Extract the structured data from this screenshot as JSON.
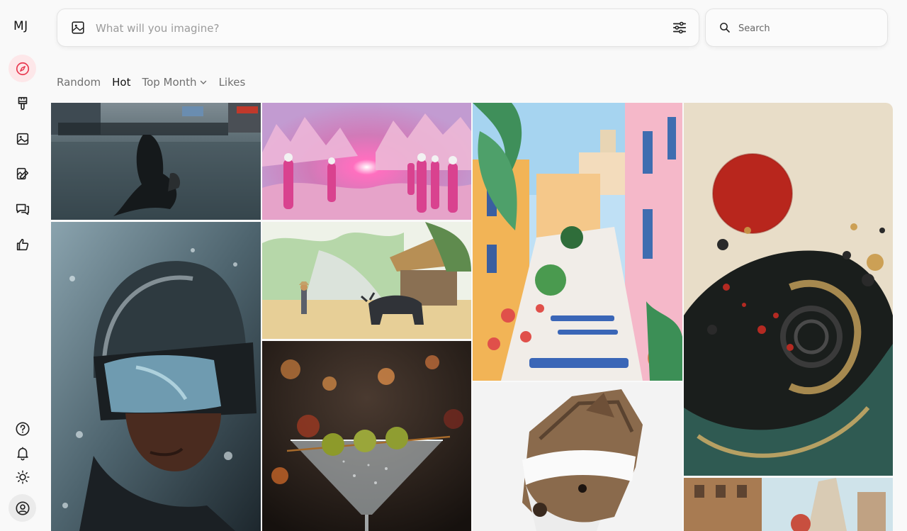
{
  "brand": {
    "logo_text": "MJ"
  },
  "sidebar": {
    "items": [
      {
        "name": "explore",
        "icon": "compass-icon",
        "active": true
      },
      {
        "name": "create",
        "icon": "paintbrush-icon",
        "active": false
      },
      {
        "name": "organize",
        "icon": "image-icon",
        "active": false
      },
      {
        "name": "edit",
        "icon": "edit-icon",
        "active": false
      },
      {
        "name": "chat",
        "icon": "chat-icon",
        "active": false
      },
      {
        "name": "likes",
        "icon": "thumbs-up-icon",
        "active": false
      }
    ],
    "bottom": [
      {
        "name": "help",
        "icon": "help-icon"
      },
      {
        "name": "notifications",
        "icon": "bell-icon"
      },
      {
        "name": "theme",
        "icon": "sun-icon"
      },
      {
        "name": "profile",
        "icon": "user-icon"
      }
    ]
  },
  "prompt": {
    "placeholder": "What will you imagine?"
  },
  "search": {
    "placeholder": "Search"
  },
  "tabs": [
    {
      "label": "Random",
      "active": false
    },
    {
      "label": "Hot",
      "active": true
    },
    {
      "label": "Top Month",
      "active": false,
      "dropdown": true
    },
    {
      "label": "Likes",
      "active": false
    }
  ],
  "colors": {
    "accent": "#e8384f",
    "active_bg": "#fde7e9"
  },
  "gallery": [
    {
      "name": "flooded-street-figure",
      "colors": [
        "#5a6d78",
        "#3e4f57",
        "#1d2528"
      ]
    },
    {
      "name": "pink-canyon-explorers",
      "colors": [
        "#e9a1c8",
        "#d27ab6",
        "#f6d2e6"
      ]
    },
    {
      "name": "watercolor-town-stairs",
      "colors": [
        "#8fc3e8",
        "#f2c064",
        "#e07a46"
      ]
    },
    {
      "name": "abstract-red-sun-splatter",
      "colors": [
        "#e7dcc8",
        "#c02c22",
        "#1f2a28"
      ]
    },
    {
      "name": "snow-goggles-portrait",
      "colors": [
        "#6f8a96",
        "#2e3b44",
        "#1a2228"
      ]
    },
    {
      "name": "watercolor-buffalo-farm",
      "colors": [
        "#a9cf9a",
        "#e9d2a0",
        "#5d6c52"
      ]
    },
    {
      "name": "martini-olives",
      "colors": [
        "#3c2b22",
        "#9aa63a",
        "#c86a2a"
      ]
    },
    {
      "name": "wooden-dog-sculpture",
      "colors": [
        "#efefef",
        "#8a6a4c",
        "#ffffff"
      ]
    },
    {
      "name": "ruined-city-scene",
      "colors": [
        "#b58b5c",
        "#8ec1d6",
        "#d9c2a3"
      ]
    }
  ]
}
